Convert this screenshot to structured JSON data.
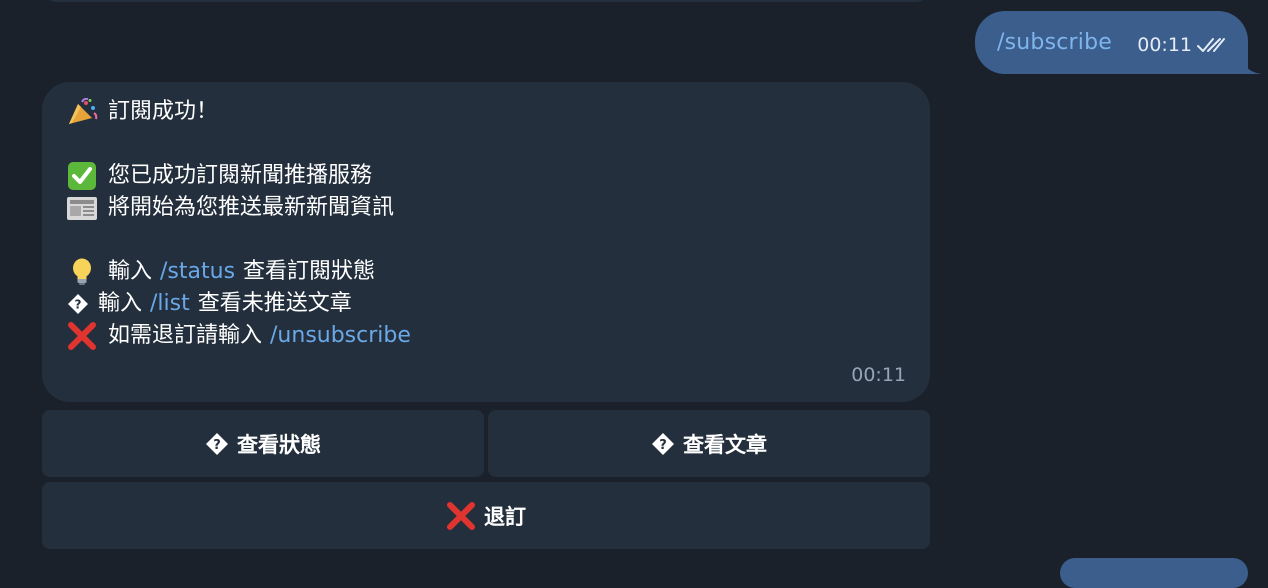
{
  "outgoing_message": {
    "command": "/subscribe",
    "time": "00:11",
    "status_icon": "double-check-icon",
    "bubble_color": "#3b5e8c"
  },
  "incoming_message": {
    "bubble_color": "#242f3d",
    "line1_text": "訂閱成功！",
    "line1_icon": "party-popper-icon",
    "line2_text": "您已成功訂閱新聞推播服務",
    "line2_icon": "check-mark-icon",
    "line3_text": "將開始為您推送最新新聞資訊",
    "line3_icon": "newspaper-icon",
    "line4_prefix": "輸入",
    "line4_command": "/status",
    "line4_suffix": "查看訂閱狀態",
    "line4_icon": "light-bulb-icon",
    "line5_prefix": "輸入",
    "line5_command": "/list",
    "line5_suffix": "查看未推送文章",
    "line5_icon": "unknown-glyph-icon",
    "line6_prefix": "如需退訂請輸入",
    "line6_command": "/unsubscribe",
    "line6_icon": "cross-mark-icon",
    "time": "00:11",
    "link_color": "#6aa8e8"
  },
  "keyboard": {
    "status_label": "查看狀態",
    "status_icon": "unknown-glyph-icon",
    "articles_label": "查看文章",
    "articles_icon": "unknown-glyph-icon",
    "unsubscribe_label": "退訂",
    "unsubscribe_icon": "cross-mark-icon"
  }
}
